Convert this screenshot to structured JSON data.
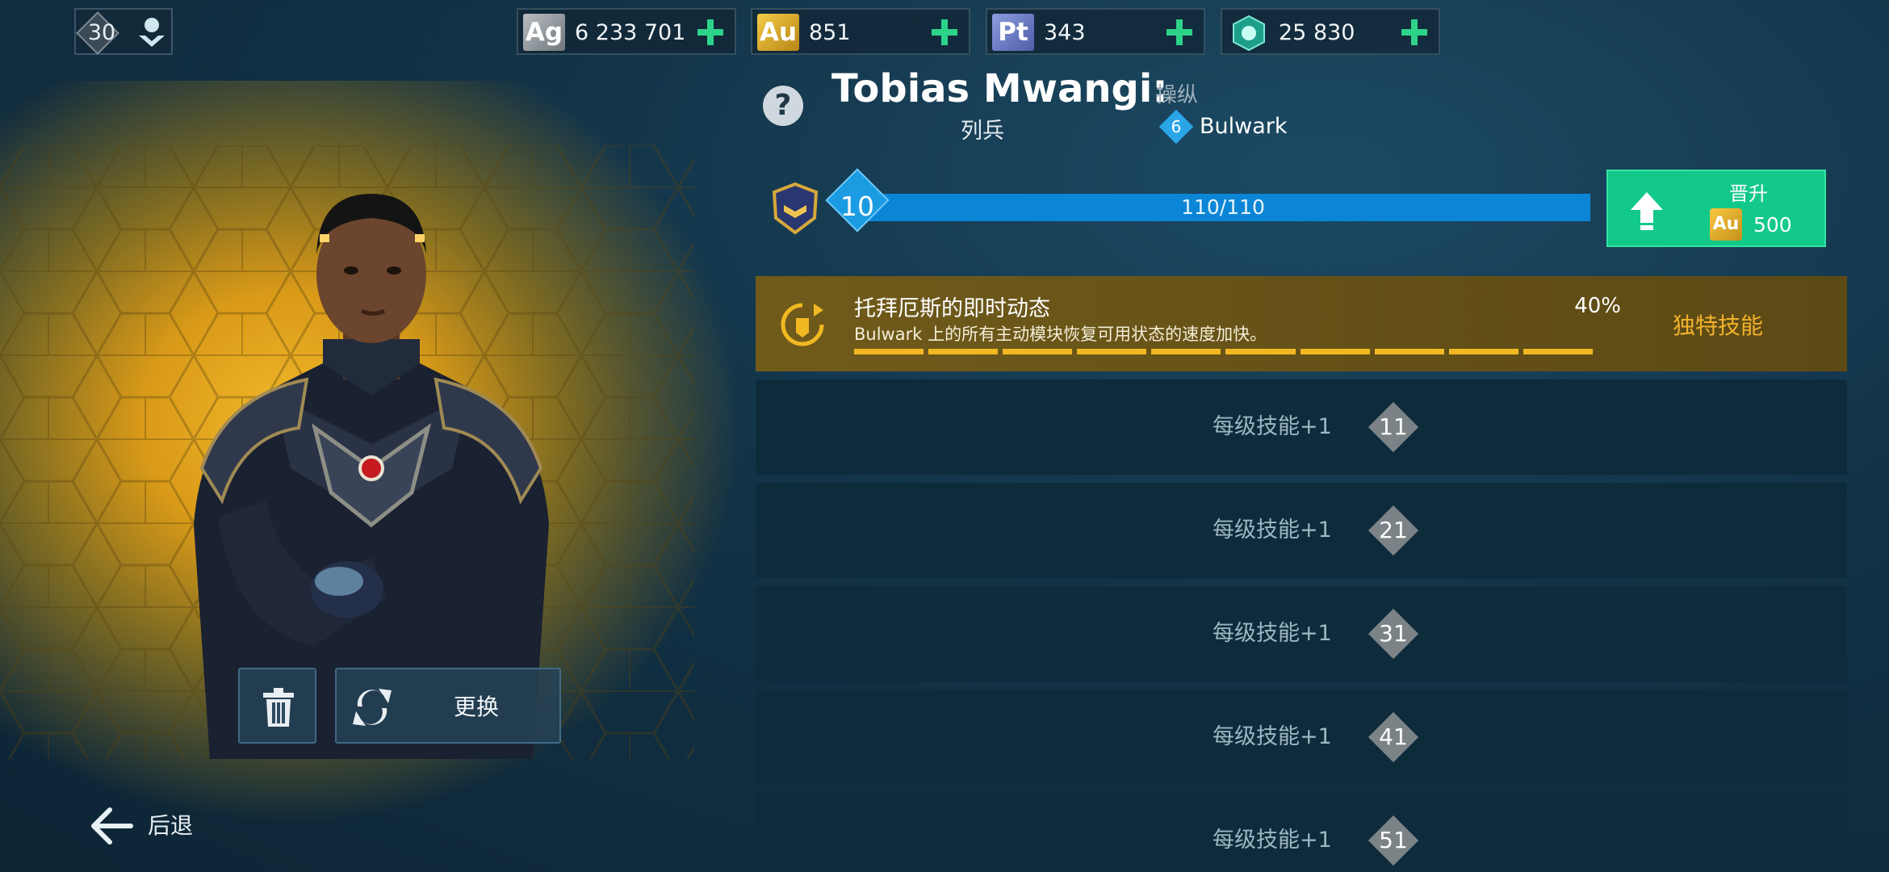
{
  "player": {
    "level": "30"
  },
  "resources": [
    {
      "tag": "Ag",
      "value": "6 233 701",
      "color": "#8f969b"
    },
    {
      "tag": "Au",
      "value": "851",
      "color": "#d9a722"
    },
    {
      "tag": "Pt",
      "value": "343",
      "color": "#6f7fc6"
    },
    {
      "tag": "",
      "icon": "dilithium-icon",
      "value": "25 830",
      "color": "#2fb7a0"
    }
  ],
  "officer": {
    "name": "Tobias Mwangi:",
    "rank": "列兵",
    "role": "操纵",
    "ship_level": "6",
    "ship_name": "Bulwark",
    "level": "10",
    "xp_text": "110/110",
    "xp_fraction": 1.0
  },
  "promote": {
    "label": "晋升",
    "currency": "Au",
    "cost": "500"
  },
  "ability": {
    "title": "托拜厄斯的即时动态",
    "description": "Bulwark 上的所有主动模块恢复可用状态的速度加快。",
    "percent": "40%",
    "type": "独特技能",
    "segments": 10
  },
  "milestones": [
    {
      "label": "每级技能+1",
      "level": "11"
    },
    {
      "label": "每级技能+1",
      "level": "21"
    },
    {
      "label": "每级技能+1",
      "level": "31"
    },
    {
      "label": "每级技能+1",
      "level": "41"
    },
    {
      "label": "每级技能+1",
      "level": "51"
    }
  ],
  "actions": {
    "swap_label": "更换",
    "back_label": "后退"
  },
  "colors": {
    "accent_green": "#13c98a",
    "xp_blue": "#0d7cc6",
    "ability_gold": "#f2b822"
  }
}
